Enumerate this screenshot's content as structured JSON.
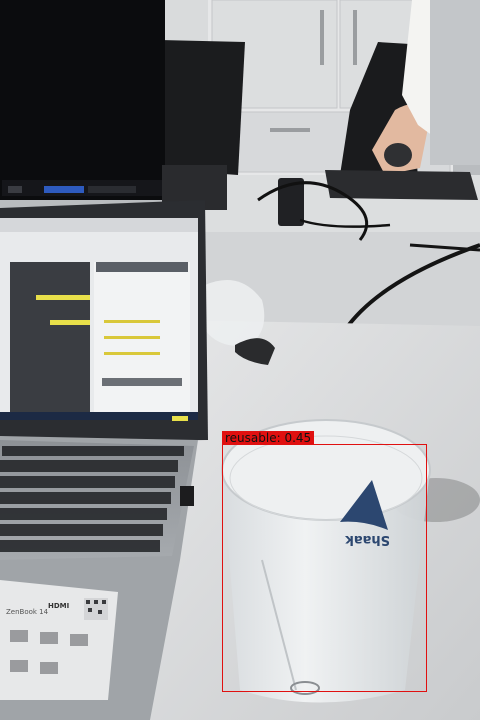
{
  "detection": {
    "label": "reusable",
    "score": "0.45",
    "caption": "reusable: 0.45",
    "color": "#e01010"
  },
  "laptop_screen": {
    "notice": "Can't use Java 16.0.1 and Gradle 5.6.1 to import Gradle project.",
    "button_primary": "Upgrade Gradle to 7.0.1",
    "button_secondary": "Set the Java Development Kit"
  },
  "laptop_stickers": {
    "model": "ZenBook 14",
    "brand": "HDMI"
  },
  "cup_print": {
    "brand": "Shaak"
  }
}
